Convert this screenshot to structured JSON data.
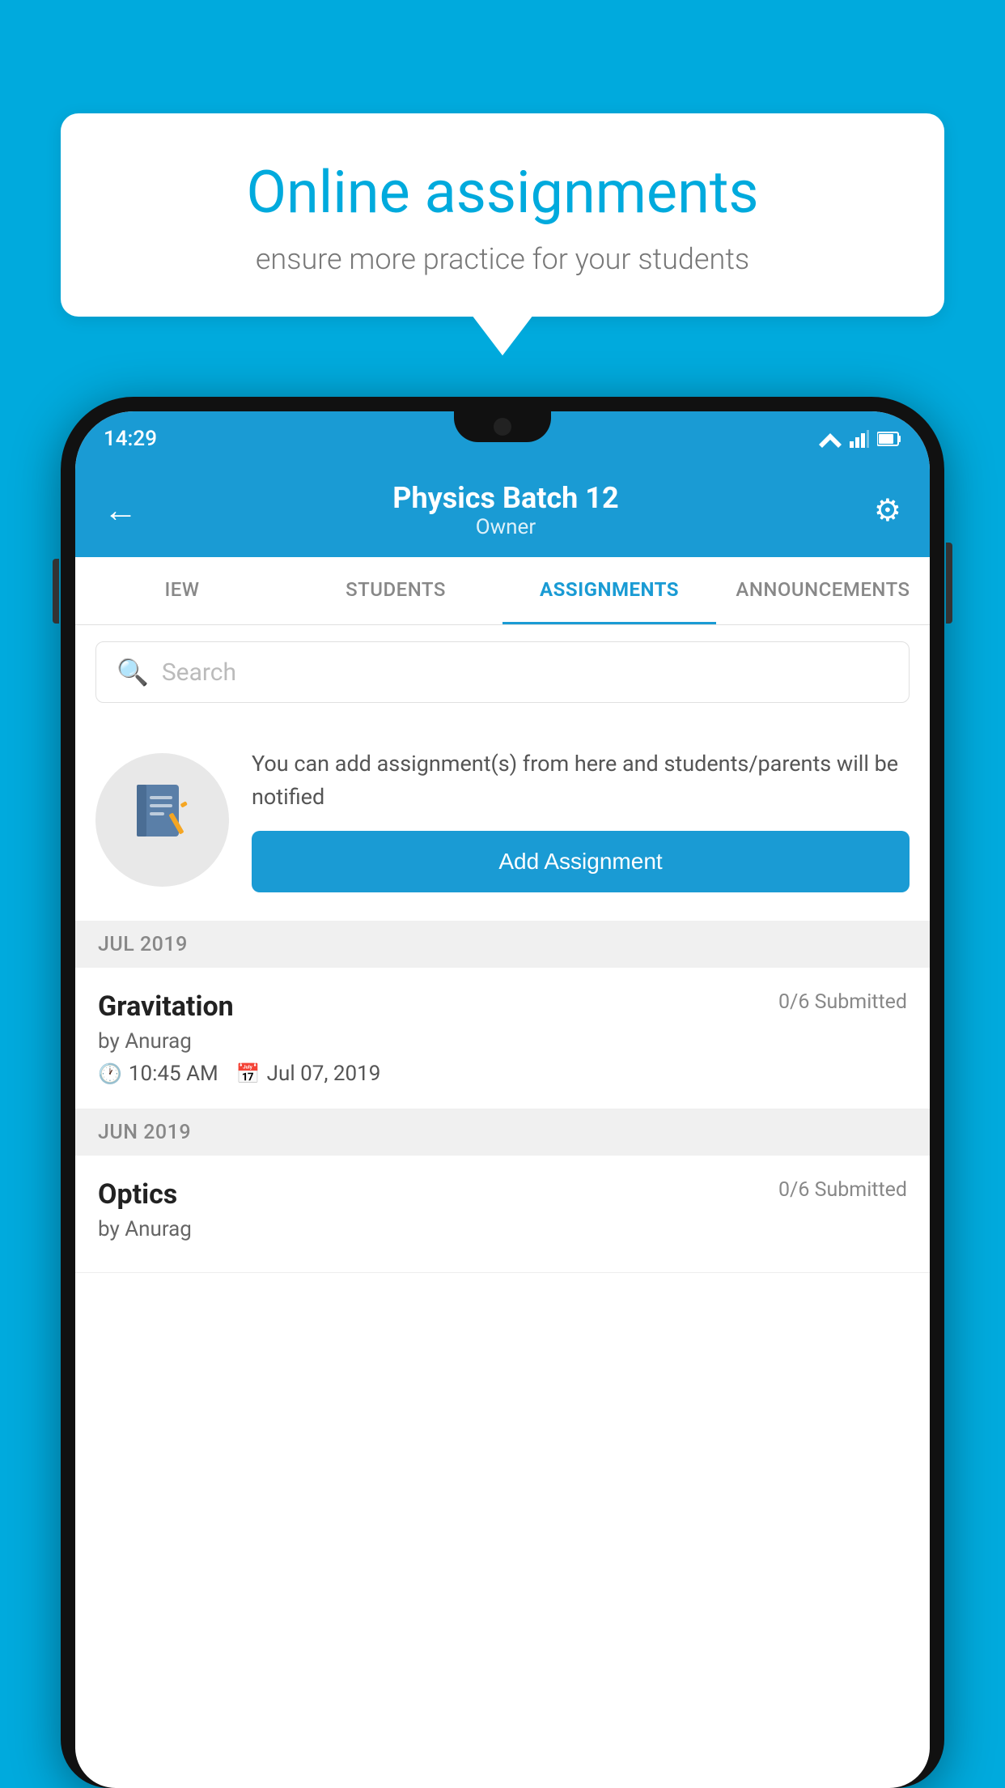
{
  "bubble": {
    "title": "Online assignments",
    "subtitle": "ensure more practice for your students"
  },
  "phone": {
    "status_time": "14:29",
    "header": {
      "title": "Physics Batch 12",
      "subtitle": "Owner",
      "back_label": "←",
      "gear_label": "⚙"
    },
    "tabs": [
      {
        "label": "IEW",
        "active": false
      },
      {
        "label": "STUDENTS",
        "active": false
      },
      {
        "label": "ASSIGNMENTS",
        "active": true
      },
      {
        "label": "ANNOUNCEMENTS",
        "active": false
      }
    ],
    "search": {
      "placeholder": "Search"
    },
    "promo": {
      "icon": "📓",
      "text": "You can add assignment(s) from here and students/parents will be notified",
      "button_label": "Add Assignment"
    },
    "sections": [
      {
        "month": "JUL 2019",
        "assignments": [
          {
            "title": "Gravitation",
            "submitted": "0/6 Submitted",
            "by": "by Anurag",
            "time": "10:45 AM",
            "date": "Jul 07, 2019"
          }
        ]
      },
      {
        "month": "JUN 2019",
        "assignments": [
          {
            "title": "Optics",
            "submitted": "0/6 Submitted",
            "by": "by Anurag",
            "time": "",
            "date": ""
          }
        ]
      }
    ]
  }
}
